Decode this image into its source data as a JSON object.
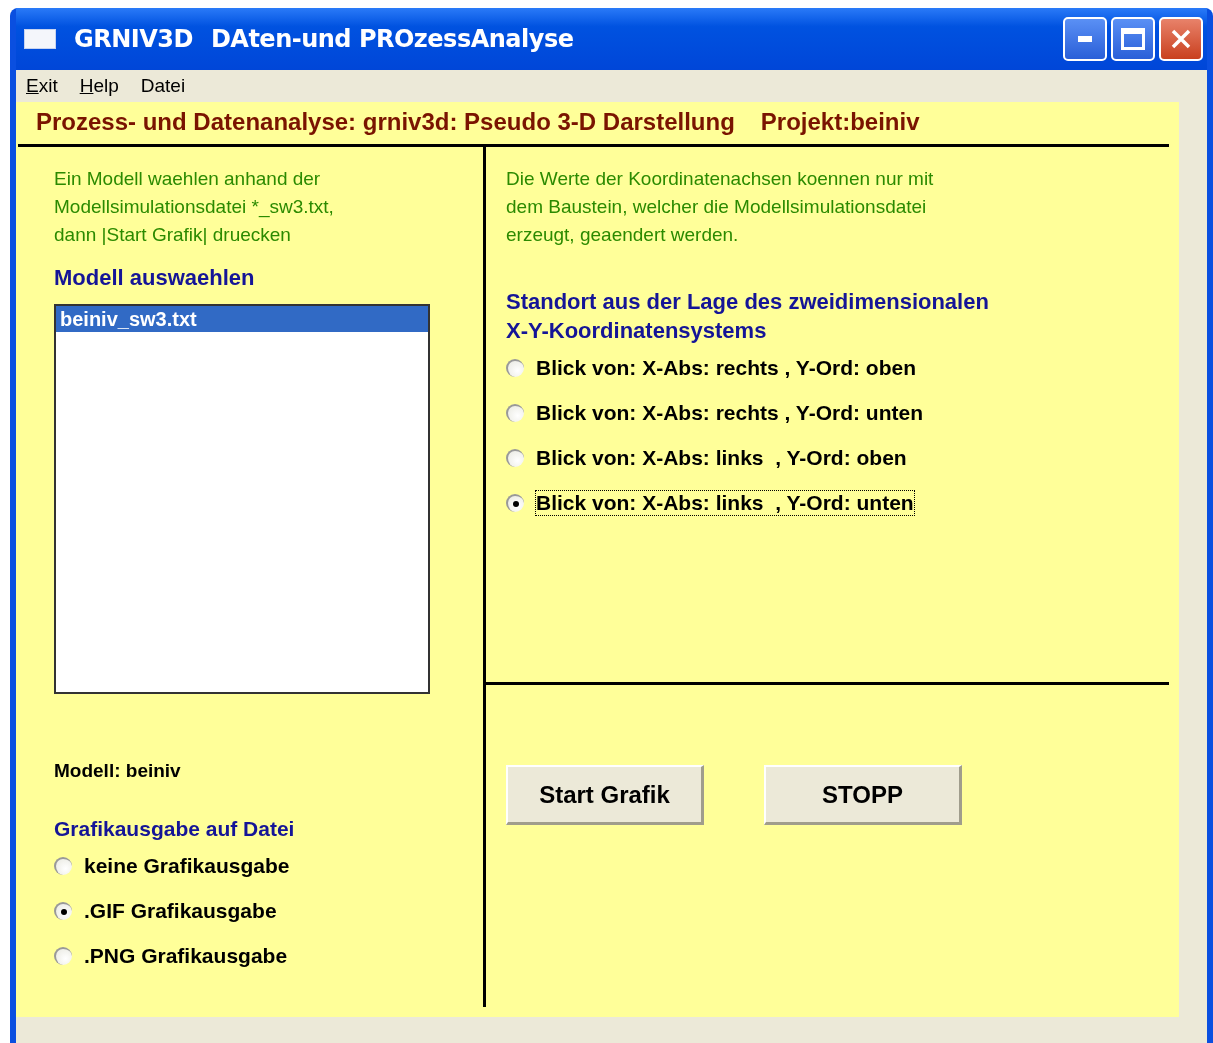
{
  "window": {
    "app_name": "GRNIV3D",
    "title": "DAten-und PROzessAnalyse"
  },
  "menu": [
    {
      "label": "Exit",
      "underline_first": true
    },
    {
      "label": "Help",
      "underline_first": true
    },
    {
      "label": "Datei",
      "underline_first": false
    }
  ],
  "header": {
    "title": "Prozess- und Datenanalyse: grniv3d: Pseudo 3-D Darstellung",
    "project": "Projekt:beiniv"
  },
  "left": {
    "instructions": [
      "Ein Modell waehlen anhand der",
      "Modellsimulationsdatei *_sw3.txt,",
      "dann  |Start Grafik|  druecken"
    ],
    "model_heading": "Modell auswaehlen",
    "model_list": [
      {
        "label": "beiniv_sw3.txt",
        "selected": true
      }
    ],
    "model_info": "Modell: beiniv",
    "output_heading": "Grafikausgabe auf Datei",
    "output_options": [
      {
        "label": "keine Grafikausgabe",
        "selected": false
      },
      {
        "label": ".GIF Grafikausgabe",
        "selected": true
      },
      {
        "label": ".PNG Grafikausgabe",
        "selected": false
      }
    ]
  },
  "right": {
    "note": [
      "Die Werte der Koordinatenachsen koennen nur mit",
      "dem Baustein, welcher die Modellsimulationsdatei",
      "erzeugt, geaendert werden."
    ],
    "view_heading": [
      "Standort aus der Lage des zweidimensionalen",
      "X-Y-Koordinatensystems"
    ],
    "view_options": [
      {
        "label": "Blick von: X-Abs: rechts , Y-Ord: oben",
        "selected": false
      },
      {
        "label": "Blick von: X-Abs: rechts , Y-Ord: unten",
        "selected": false
      },
      {
        "label": "Blick von: X-Abs: links  , Y-Ord: oben",
        "selected": false
      },
      {
        "label": "Blick von: X-Abs: links  , Y-Ord: unten",
        "selected": true
      }
    ],
    "buttons": [
      "Start Grafik",
      "STOPP"
    ]
  }
}
